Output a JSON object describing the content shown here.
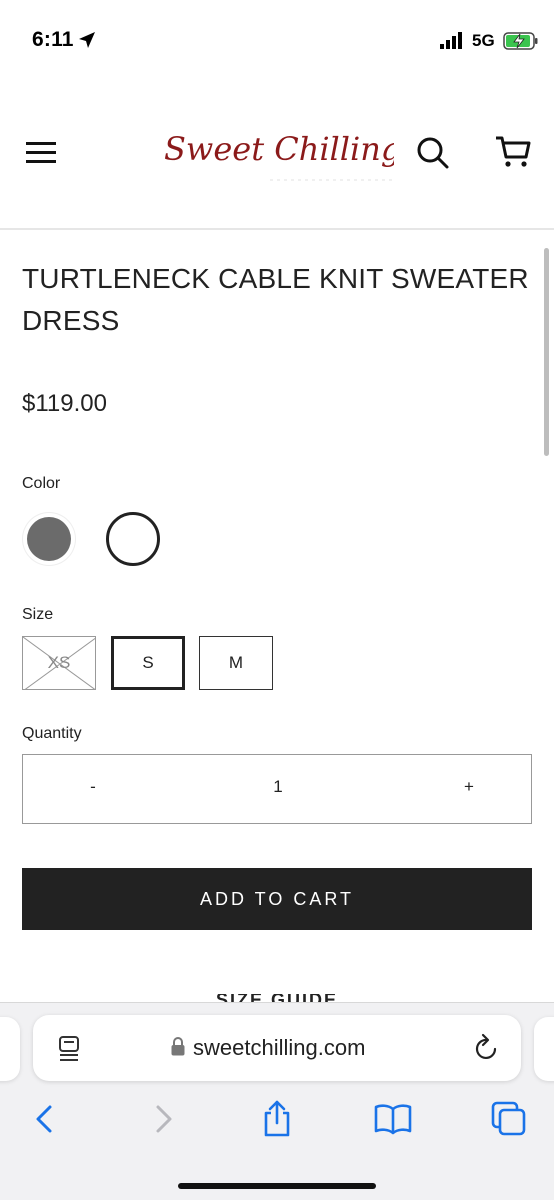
{
  "status_bar": {
    "time": "6:11",
    "network": "5G"
  },
  "header": {
    "logo_text": "Sweet Chilling"
  },
  "product": {
    "title": "TURTLENECK CABLE KNIT SWEATER DRESS",
    "price": "$119.00",
    "color_label": "Color",
    "colors": [
      "#6b6b6b",
      "#ffffff"
    ],
    "selected_color_index": 1,
    "size_label": "Size",
    "sizes": [
      {
        "label": "XS",
        "available": false
      },
      {
        "label": "S",
        "available": true,
        "selected": true
      },
      {
        "label": "M",
        "available": true
      }
    ],
    "quantity_label": "Quantity",
    "quantity": {
      "minus": "-",
      "value": "1",
      "plus": "+"
    },
    "add_to_cart_label": "ADD TO CART",
    "size_guide_label": "SIZE GUIDE"
  },
  "browser": {
    "url": "sweetchilling.com"
  },
  "colors": {
    "logo": "#8b1a1a",
    "button_bg": "#222222",
    "accent_blue": "#1a73e8"
  }
}
